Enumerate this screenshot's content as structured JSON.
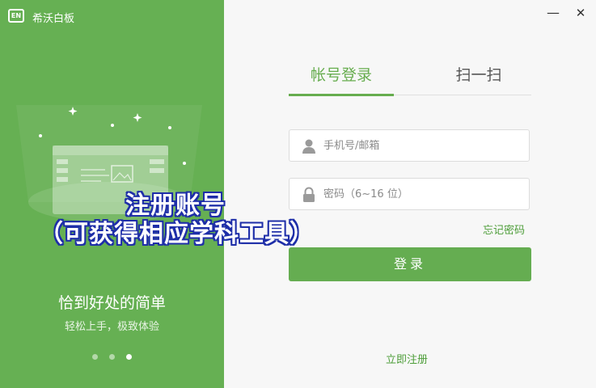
{
  "window": {
    "app_name": "希沃白板",
    "logo_text": "EN",
    "minimize_label": "—",
    "close_label": "✕"
  },
  "left_panel": {
    "slogan": "恰到好处的简单",
    "subslogan": "轻松上手，极致体验",
    "carousel": {
      "count": 3,
      "active_index": 2
    }
  },
  "tabs": [
    {
      "label": "帐号登录",
      "active": true
    },
    {
      "label": "扫一扫",
      "active": false
    }
  ],
  "form": {
    "phone_placeholder": "手机号/邮箱",
    "password_placeholder": "密码（6~16 位）",
    "forgot_label": "忘记密码",
    "login_label": "登录",
    "register_label": "立即注册"
  },
  "overlay": {
    "line1": "注册账号",
    "line2": "（可获得相应学科工具）"
  },
  "colors": {
    "brand_green": "#66b053",
    "link_green": "#4e9e3a",
    "overlay_stroke": "#1e2ea8"
  },
  "icons": [
    "user-icon",
    "lock-icon",
    "whiteboard-illustration"
  ]
}
